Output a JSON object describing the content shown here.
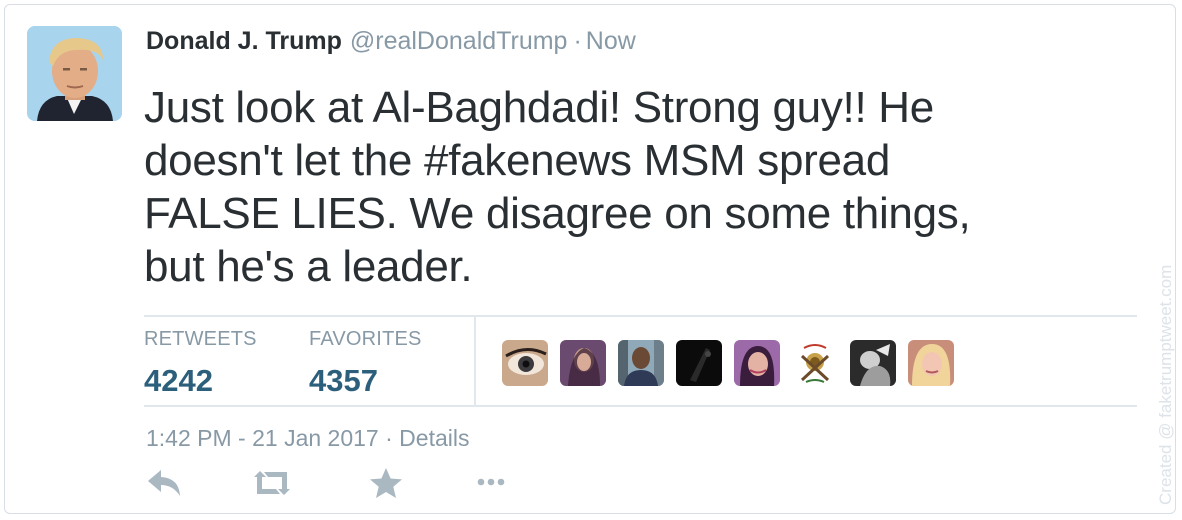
{
  "tweet": {
    "name": "Donald J. Trump",
    "handle": "@realDonaldTrump",
    "separator": "·",
    "time_ago": "Now",
    "text_lines": [
      "Just look at Al-Baghdadi! Strong guy!! He",
      "doesn't let the #fakenews MSM spread",
      "FALSE LIES. We disagree on some things,",
      "but he's a leader."
    ]
  },
  "stats": {
    "retweets_label": "RETWEETS",
    "retweets_value": "4242",
    "favorites_label": "FAVORITES",
    "favorites_value": "4357"
  },
  "meta": {
    "timestamp": "1:42 PM - 21 Jan 2017",
    "separator": "·",
    "details_link": "Details"
  },
  "actions": [
    "reply-icon",
    "retweet-icon",
    "favorite-icon",
    "more-icon"
  ],
  "watermark": "Created @ faketrumptweet.com",
  "colors": {
    "text": "#292f33",
    "muted": "#8899a6",
    "stat_value": "#2c5f7c",
    "action_icon": "#aab8c2",
    "divider": "#e1e8ed"
  }
}
